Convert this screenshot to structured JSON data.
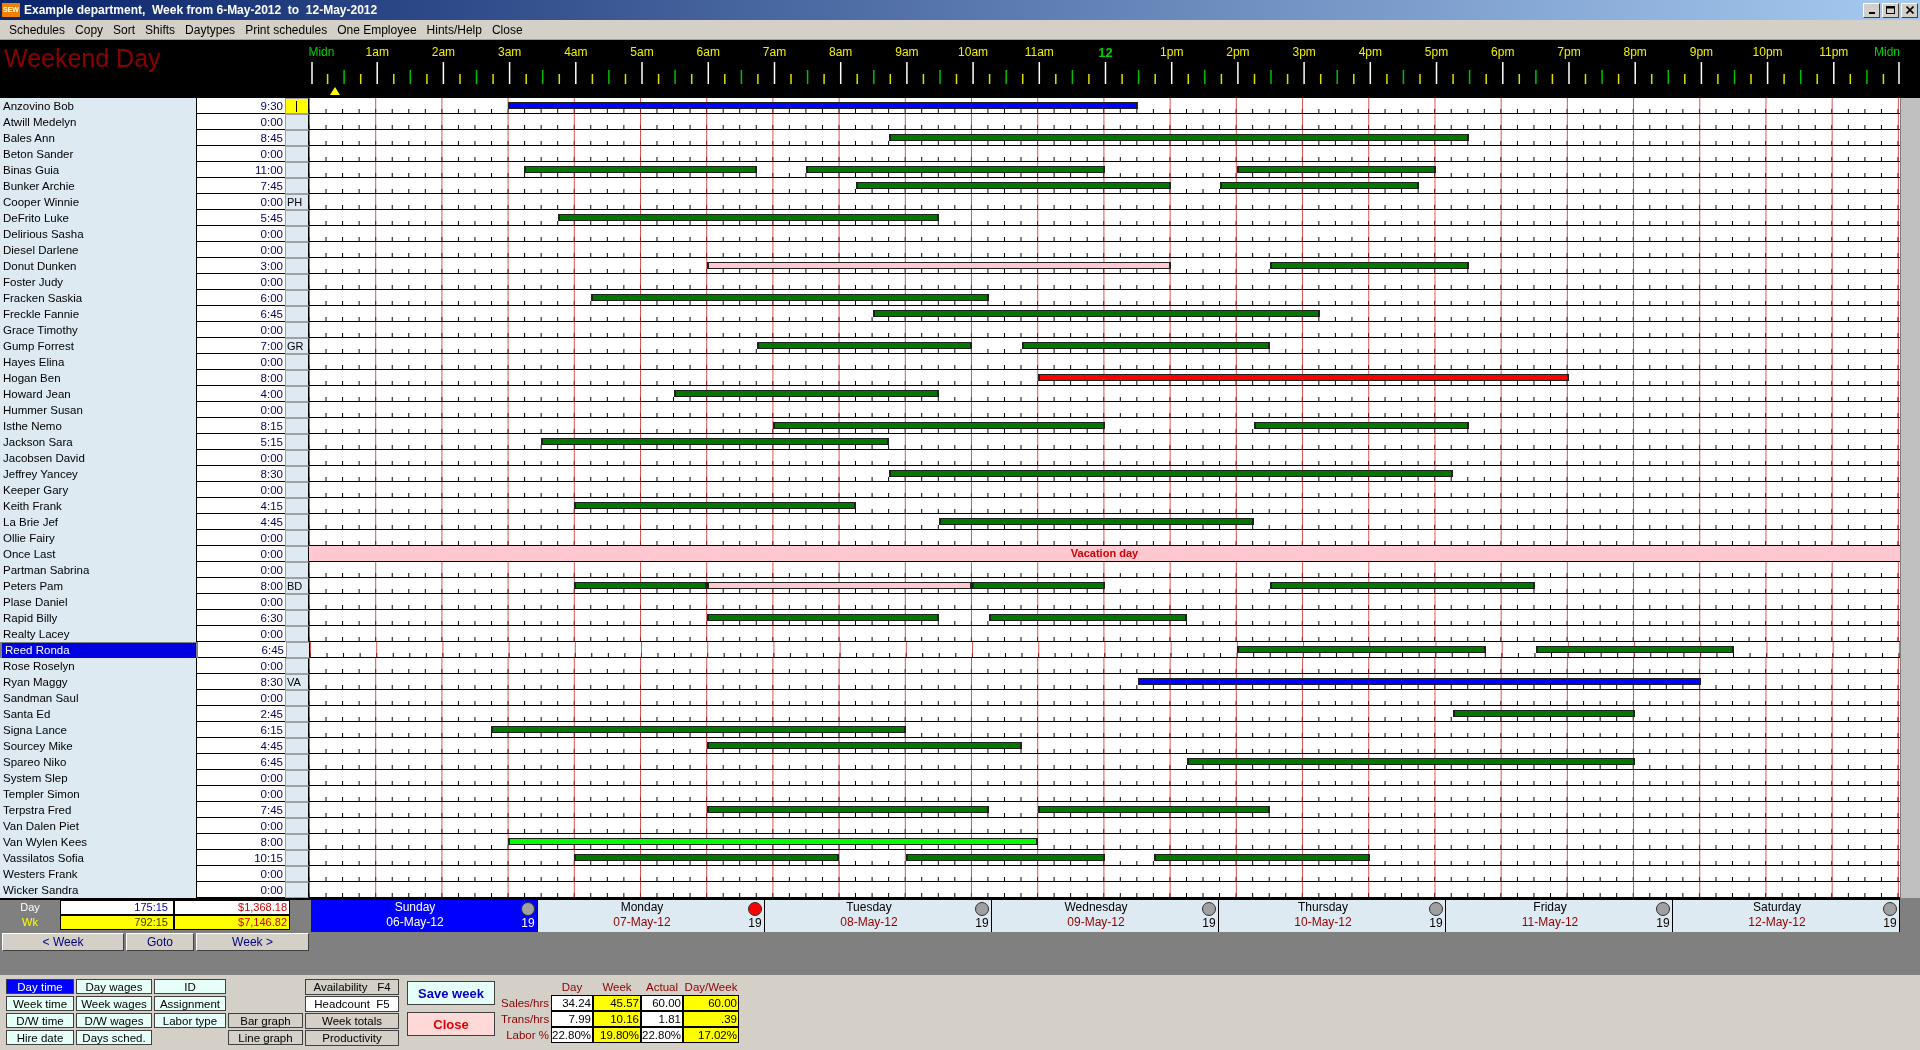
{
  "window": {
    "app_icon": "SEW",
    "title": "Example department,  Week from 6-May-2012  to  12-May-2012"
  },
  "menu": [
    "Schedules",
    "Copy",
    "Sort",
    "Shifts",
    "Daytypes",
    "Print schedules",
    "One Employee",
    "Hints/Help",
    "Close"
  ],
  "header": {
    "day_type": "Weekend Day",
    "time_marker": {
      "level": 0.015
    },
    "hour_labels": [
      {
        "label": "Midn",
        "kind": "midnight"
      },
      {
        "label": "1am",
        "kind": "hour"
      },
      {
        "label": "2am",
        "kind": "hour"
      },
      {
        "label": "3am",
        "kind": "hour"
      },
      {
        "label": "4am",
        "kind": "hour"
      },
      {
        "label": "5am",
        "kind": "hour"
      },
      {
        "label": "6am",
        "kind": "hour"
      },
      {
        "label": "7am",
        "kind": "hour"
      },
      {
        "label": "8am",
        "kind": "hour"
      },
      {
        "label": "9am",
        "kind": "hour"
      },
      {
        "label": "10am",
        "kind": "hour"
      },
      {
        "label": "11am",
        "kind": "hour"
      },
      {
        "label": "12",
        "kind": "noon"
      },
      {
        "label": "1pm",
        "kind": "hour"
      },
      {
        "label": "2pm",
        "kind": "hour"
      },
      {
        "label": "3pm",
        "kind": "hour"
      },
      {
        "label": "4pm",
        "kind": "hour"
      },
      {
        "label": "5pm",
        "kind": "hour"
      },
      {
        "label": "6pm",
        "kind": "hour"
      },
      {
        "label": "7pm",
        "kind": "hour"
      },
      {
        "label": "8pm",
        "kind": "hour"
      },
      {
        "label": "9pm",
        "kind": "hour"
      },
      {
        "label": "10pm",
        "kind": "hour"
      },
      {
        "label": "11pm",
        "kind": "hour"
      },
      {
        "label": "Midn",
        "kind": "midnight"
      }
    ]
  },
  "employees": [
    {
      "name": "Anzovino Bob",
      "hours": "9:30",
      "selected": false,
      "editing": true,
      "shifts": [
        {
          "color": "#0000ff",
          "from": {
            "level": 0.125
          },
          "to": {
            "level": 0.5208
          }
        }
      ]
    },
    {
      "name": "Atwill Medelyn",
      "hours": "0:00",
      "selected": false,
      "editing": false
    },
    {
      "name": "Bales Ann",
      "hours": "8:45",
      "selected": false,
      "editing": false,
      "shifts": [
        {
          "color": "#007800",
          "from": {
            "level": 0.3646
          },
          "to": {
            "level": 0.7292
          }
        }
      ]
    },
    {
      "name": "Beton Sander",
      "hours": "0:00",
      "selected": false,
      "editing": false
    },
    {
      "name": "Binas Guia",
      "hours": "11:00",
      "selected": false,
      "editing": false,
      "shifts": [
        {
          "color": "#007800",
          "from": {
            "level": 0.1354
          },
          "to": {
            "level": 0.2813
          }
        },
        {
          "color": "#007800",
          "from": {
            "level": 0.3125
          },
          "to": {
            "level": 0.5
          }
        },
        {
          "color": "#007800",
          "from": {
            "level": 0.5833
          },
          "to": {
            "level": 0.7083
          }
        }
      ]
    },
    {
      "name": "Bunker Archie",
      "hours": "7:45",
      "selected": false,
      "editing": false,
      "shifts": [
        {
          "color": "#007800",
          "from": {
            "level": 0.3438
          },
          "to": {
            "level": 0.5417
          }
        },
        {
          "color": "#007800",
          "from": {
            "level": 0.5729
          },
          "to": {
            "level": 0.6979
          }
        }
      ]
    },
    {
      "name": "Cooper Winnie",
      "hours": "0:00",
      "code": "PH",
      "selected": false,
      "editing": false
    },
    {
      "name": "DeFrito Luke",
      "hours": "5:45",
      "selected": false,
      "editing": false,
      "shifts": [
        {
          "color": "#007800",
          "from": {
            "level": 0.1563
          },
          "to": {
            "level": 0.3958
          }
        }
      ]
    },
    {
      "name": "Delirious Sasha",
      "hours": "0:00",
      "selected": false,
      "editing": false
    },
    {
      "name": "Diesel Darlene",
      "hours": "0:00",
      "selected": false,
      "editing": false
    },
    {
      "name": "Donut Dunken",
      "hours": "3:00",
      "selected": false,
      "editing": false,
      "shifts": [
        {
          "color": "#ffc8d0",
          "from": {
            "level": 0.25
          },
          "to": {
            "level": 0.5417
          }
        },
        {
          "color": "#007800",
          "from": {
            "level": 0.6042
          },
          "to": {
            "level": 0.7292
          }
        }
      ]
    },
    {
      "name": "Foster Judy",
      "hours": "0:00",
      "selected": false,
      "editing": false
    },
    {
      "name": "Fracken Saskia",
      "hours": "6:00",
      "selected": false,
      "editing": false,
      "shifts": [
        {
          "color": "#007800",
          "from": {
            "level": 0.1771
          },
          "to": {
            "level": 0.4271
          }
        }
      ]
    },
    {
      "name": "Freckle Fannie",
      "hours": "6:45",
      "selected": false,
      "editing": false,
      "shifts": [
        {
          "color": "#007800",
          "from": {
            "level": 0.3542
          },
          "to": {
            "level": 0.6354
          }
        }
      ]
    },
    {
      "name": "Grace Timothy",
      "hours": "0:00",
      "selected": false,
      "editing": false
    },
    {
      "name": "Gump Forrest",
      "hours": "7:00",
      "code": "GR",
      "selected": false,
      "editing": false,
      "shifts": [
        {
          "color": "#007800",
          "from": {
            "level": 0.2813
          },
          "to": {
            "level": 0.4167
          }
        },
        {
          "color": "#007800",
          "from": {
            "level": 0.4479
          },
          "to": {
            "level": 0.6042
          }
        }
      ]
    },
    {
      "name": "Hayes Elina",
      "hours": "0:00",
      "selected": false,
      "editing": false
    },
    {
      "name": "Hogan Ben",
      "hours": "8:00",
      "selected": false,
      "editing": false,
      "shifts": [
        {
          "color": "#ff0000",
          "from": {
            "level": 0.4583
          },
          "to": {
            "level": 0.7917
          }
        }
      ]
    },
    {
      "name": "Howard Jean",
      "hours": "4:00",
      "selected": false,
      "editing": false,
      "shifts": [
        {
          "color": "#007800",
          "from": {
            "level": 0.2292
          },
          "to": {
            "level": 0.3958
          }
        }
      ]
    },
    {
      "name": "Hummer Susan",
      "hours": "0:00",
      "selected": false,
      "editing": false
    },
    {
      "name": "Isthe Nemo",
      "hours": "8:15",
      "selected": false,
      "editing": false,
      "shifts": [
        {
          "color": "#007800",
          "from": {
            "level": 0.2917
          },
          "to": {
            "level": 0.5
          }
        },
        {
          "color": "#007800",
          "from": {
            "level": 0.5938
          },
          "to": {
            "level": 0.7292
          }
        }
      ]
    },
    {
      "name": "Jackson Sara",
      "hours": "5:15",
      "selected": false,
      "editing": false,
      "shifts": [
        {
          "color": "#007800",
          "from": {
            "level": 0.1458
          },
          "to": {
            "level": 0.3646
          }
        }
      ]
    },
    {
      "name": "Jacobsen David",
      "hours": "0:00",
      "selected": false,
      "editing": false
    },
    {
      "name": "Jeffrey Yancey",
      "hours": "8:30",
      "selected": false,
      "editing": false,
      "shifts": [
        {
          "color": "#007800",
          "from": {
            "level": 0.3646
          },
          "to": {
            "level": 0.7188
          }
        }
      ]
    },
    {
      "name": "Keeper Gary",
      "hours": "0:00",
      "selected": false,
      "editing": false
    },
    {
      "name": "Keith Frank",
      "hours": "4:15",
      "selected": false,
      "editing": false,
      "shifts": [
        {
          "color": "#007800",
          "from": {
            "level": 0.1667
          },
          "to": {
            "level": 0.3438
          }
        }
      ]
    },
    {
      "name": "La Brie Jef",
      "hours": "4:45",
      "selected": false,
      "editing": false,
      "shifts": [
        {
          "color": "#007800",
          "from": {
            "level": 0.3958
          },
          "to": {
            "level": 0.5938
          }
        }
      ]
    },
    {
      "name": "Ollie Fairy",
      "hours": "0:00",
      "selected": false,
      "editing": false
    },
    {
      "name": "Once Last",
      "hours": "0:00",
      "selected": false,
      "editing": false,
      "absence": "Vacation day"
    },
    {
      "name": "Partman Sabrina",
      "hours": "0:00",
      "selected": false,
      "editing": false
    },
    {
      "name": "Peters Pam",
      "hours": "8:00",
      "code": "BD",
      "selected": false,
      "editing": false,
      "shifts": [
        {
          "color": "#007800",
          "from": {
            "level": 0.1667
          },
          "to": {
            "level": 0.25
          }
        },
        {
          "color": "#ffc8d0",
          "from": {
            "level": 0.25
          },
          "to": {
            "level": 0.4167
          }
        },
        {
          "color": "#007800",
          "from": {
            "level": 0.4167
          },
          "to": {
            "level": 0.5
          }
        },
        {
          "color": "#007800",
          "from": {
            "level": 0.6042
          },
          "to": {
            "level": 0.7708
          }
        }
      ]
    },
    {
      "name": "Plase Daniel",
      "hours": "0:00",
      "selected": false,
      "editing": false
    },
    {
      "name": "Rapid Billy",
      "hours": "6:30",
      "selected": false,
      "editing": false,
      "shifts": [
        {
          "color": "#007800",
          "from": {
            "level": 0.25
          },
          "to": {
            "level": 0.3958
          }
        },
        {
          "color": "#007800",
          "from": {
            "level": 0.4271
          },
          "to": {
            "level": 0.5521
          }
        }
      ]
    },
    {
      "name": "Realty Lacey",
      "hours": "0:00",
      "selected": false,
      "editing": false
    },
    {
      "name": "Reed Ronda",
      "hours": "6:45",
      "selected": true,
      "editing": false,
      "shifts": [
        {
          "color": "#007800",
          "from": {
            "level": 0.5833
          },
          "to": {
            "level": 0.7396
          }
        },
        {
          "color": "#007800",
          "from": {
            "level": 0.7708
          },
          "to": {
            "level": 0.8958
          }
        }
      ]
    },
    {
      "name": "Rose Roselyn",
      "hours": "0:00",
      "selected": false,
      "editing": false
    },
    {
      "name": "Ryan Maggy",
      "hours": "8:30",
      "code": "VA",
      "selected": false,
      "editing": false,
      "shifts": [
        {
          "color": "#0000ff",
          "from": {
            "level": 0.5208
          },
          "to": {
            "level": 0.875
          }
        }
      ]
    },
    {
      "name": "Sandman Saul",
      "hours": "0:00",
      "selected": false,
      "editing": false
    },
    {
      "name": "Santa Ed",
      "hours": "2:45",
      "selected": false,
      "editing": false,
      "shifts": [
        {
          "color": "#007800",
          "from": {
            "level": 0.7188
          },
          "to": {
            "level": 0.8333
          }
        }
      ]
    },
    {
      "name": "Signa Lance",
      "hours": "6:15",
      "selected": false,
      "editing": false,
      "shifts": [
        {
          "color": "#007800",
          "from": {
            "level": 0.1146
          },
          "to": {
            "level": 0.375
          }
        }
      ]
    },
    {
      "name": "Sourcey Mike",
      "hours": "4:45",
      "selected": false,
      "editing": false,
      "shifts": [
        {
          "color": "#007800",
          "from": {
            "level": 0.25
          },
          "to": {
            "level": 0.4479
          }
        }
      ]
    },
    {
      "name": "Spareo Niko",
      "hours": "6:45",
      "selected": false,
      "editing": false,
      "shifts": [
        {
          "color": "#007800",
          "from": {
            "level": 0.5521
          },
          "to": {
            "level": 0.8333
          }
        }
      ]
    },
    {
      "name": "System Slep",
      "hours": "0:00",
      "selected": false,
      "editing": false
    },
    {
      "name": "Templer Simon",
      "hours": "0:00",
      "selected": false,
      "editing": false
    },
    {
      "name": "Terpstra Fred",
      "hours": "7:45",
      "selected": false,
      "editing": false,
      "shifts": [
        {
          "color": "#007800",
          "from": {
            "level": 0.25
          },
          "to": {
            "level": 0.4271
          }
        },
        {
          "color": "#007800",
          "from": {
            "level": 0.4583
          },
          "to": {
            "level": 0.6042
          }
        }
      ]
    },
    {
      "name": "Van Dalen Piet",
      "hours": "0:00",
      "selected": false,
      "editing": false
    },
    {
      "name": "Van Wylen Kees",
      "hours": "8:00",
      "selected": false,
      "editing": false,
      "shifts": [
        {
          "color": "#00ff00",
          "from": {
            "level": 0.125
          },
          "to": {
            "level": 0.4583
          }
        }
      ]
    },
    {
      "name": "Vassilatos Sofia",
      "hours": "10:15",
      "selected": false,
      "editing": false,
      "shifts": [
        {
          "color": "#007800",
          "from": {
            "level": 0.1667
          },
          "to": {
            "level": 0.3333
          }
        },
        {
          "color": "#007800",
          "from": {
            "level": 0.375
          },
          "to": {
            "level": 0.5
          }
        },
        {
          "color": "#007800",
          "from": {
            "level": 0.5313
          },
          "to": {
            "level": 0.6667
          }
        }
      ]
    },
    {
      "name": "Westers Frank",
      "hours": "0:00",
      "selected": false,
      "editing": false
    },
    {
      "name": "Wicker Sandra",
      "hours": "0:00",
      "selected": false,
      "editing": false
    }
  ],
  "totals": [
    {
      "label": "Day",
      "hours": "175:15",
      "amount": "$1,368.18",
      "kind": "day"
    },
    {
      "label": "Wk",
      "hours": "792:15",
      "amount": "$7,146.82",
      "kind": "week"
    }
  ],
  "nav_buttons": [
    "< Week",
    "Goto",
    "Week >"
  ],
  "days": [
    {
      "name": "Sunday",
      "date": "06-May-12",
      "count": "19",
      "color": "#a0a0a0",
      "selected": true
    },
    {
      "name": "Monday",
      "date": "07-May-12",
      "count": "19",
      "color": "#ff0000",
      "selected": false
    },
    {
      "name": "Tuesday",
      "date": "08-May-12",
      "count": "19",
      "color": "#a0a0a0",
      "selected": false
    },
    {
      "name": "Wednesday",
      "date": "09-May-12",
      "count": "19",
      "color": "#a0a0a0",
      "selected": false
    },
    {
      "name": "Thursday",
      "date": "10-May-12",
      "count": "19",
      "color": "#a0a0a0",
      "selected": false
    },
    {
      "name": "Friday",
      "date": "11-May-12",
      "count": "19",
      "color": "#a0a0a0",
      "selected": false
    },
    {
      "name": "Saturday",
      "date": "12-May-12",
      "count": "19",
      "color": "#a0a0a0",
      "selected": false
    }
  ],
  "view_buttons": [
    {
      "label": "Day time",
      "selected": true
    },
    {
      "label": "Day wages",
      "selected": false
    },
    {
      "label": "ID",
      "selected": false
    },
    {
      "label": "Week time",
      "selected": false
    },
    {
      "label": "Week wages",
      "selected": false
    },
    {
      "label": "Assignment",
      "selected": false
    },
    {
      "label": "D/W time",
      "selected": false
    },
    {
      "label": "D/W wages",
      "selected": false
    },
    {
      "label": "Labor type",
      "selected": false
    },
    {
      "label": "Hire date",
      "selected": false
    },
    {
      "label": "Days sched.",
      "selected": false
    }
  ],
  "graph_buttons": [
    "Bar graph",
    "Line graph"
  ],
  "panel_buttons": [
    {
      "label": "Availability   F4",
      "selected": false
    },
    {
      "label": "Headcount  F5",
      "selected": true
    },
    {
      "label": "Week totals",
      "selected": false
    },
    {
      "label": "Productivity",
      "selected": false
    }
  ],
  "save_button": "Save week",
  "close_button": "Close",
  "stats": {
    "columns": [
      {
        "label": "Day",
        "highlighted": false
      },
      {
        "label": "Week",
        "highlighted": true
      },
      {
        "label": "Actual",
        "highlighted": false
      },
      {
        "label": "Day/Week",
        "highlighted": true
      }
    ],
    "rows": [
      {
        "label": "Sales/hrs",
        "values": [
          "34.24",
          "45.57",
          "60.00",
          "60.00"
        ]
      },
      {
        "label": "Trans/hrs",
        "values": [
          "7.99",
          "10.16",
          "1.81",
          ".39"
        ]
      },
      {
        "label": "Labor %",
        "values": [
          "22.80%",
          "19.80%",
          "22.80%",
          "17.02%"
        ]
      }
    ]
  }
}
